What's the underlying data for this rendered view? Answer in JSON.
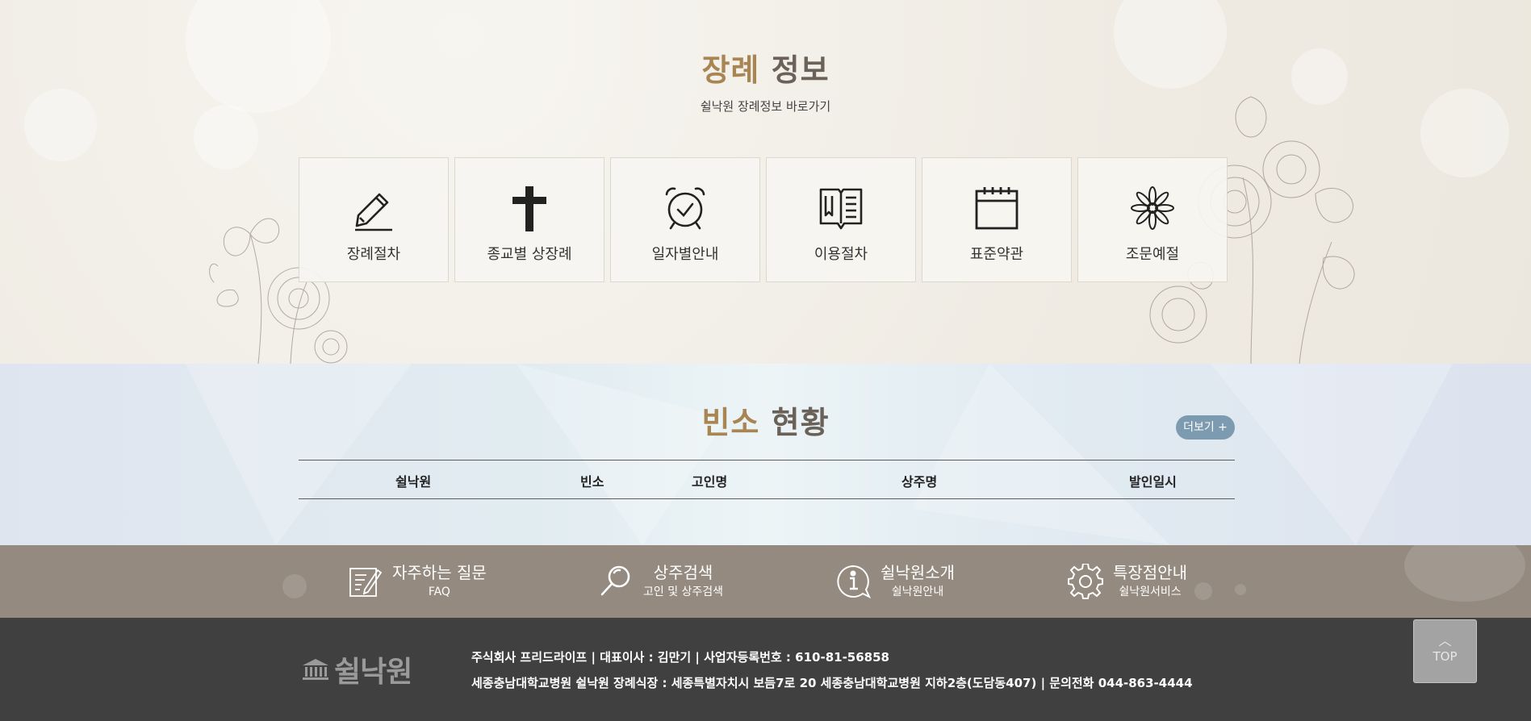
{
  "info": {
    "title_accent": "장례",
    "title_rest": " 정보",
    "subtitle": "쉴낙원 장례정보 바로가기",
    "cards": [
      {
        "label": "장례절차",
        "icon": "pencil-icon"
      },
      {
        "label": "종교별 상장례",
        "icon": "cross-icon"
      },
      {
        "label": "일자별안내",
        "icon": "alarm-clock-icon"
      },
      {
        "label": "이용절차",
        "icon": "open-book-icon"
      },
      {
        "label": "표준약관",
        "icon": "calendar-icon"
      },
      {
        "label": "조문예절",
        "icon": "chrysanthemum-icon"
      }
    ]
  },
  "status": {
    "title_accent": "빈소",
    "title_rest": " 현황",
    "more_label": "더보기 +",
    "columns": [
      "쉴낙원",
      "빈소",
      "고인명",
      "상주명",
      "발인일시"
    ]
  },
  "quick_links": [
    {
      "title": "자주하는 질문",
      "subtitle": "FAQ",
      "icon": "faq-note-icon"
    },
    {
      "title": "상주검색",
      "subtitle": "고인 및 상주검색",
      "icon": "search-icon"
    },
    {
      "title": "쉴낙원소개",
      "subtitle": "쉴낙원안내",
      "icon": "info-icon"
    },
    {
      "title": "특장점안내",
      "subtitle": "쉴낙원서비스",
      "icon": "gear-icon"
    }
  ],
  "footer": {
    "logo_text": "쉴낙원",
    "line1": "주식회사 프리드라이프  |  대표이사 : 김만기  |  사업자등록번호 : 610-81-56858",
    "line2": "세종충남대학교병원 쉴낙원 장례식장 : 세종특별자치시 보듬7로 20 세종충남대학교병원 지하2층(도담동407)  |  문의전화 044-863-4444"
  },
  "top_button": {
    "arrow": "︿",
    "label": "TOP"
  },
  "colors": {
    "accent": "#a88553",
    "title_gray": "#6a6159",
    "quick_bg": "#948a7f",
    "footer_bg": "#404040",
    "more_btn": "#7d9bb0"
  }
}
